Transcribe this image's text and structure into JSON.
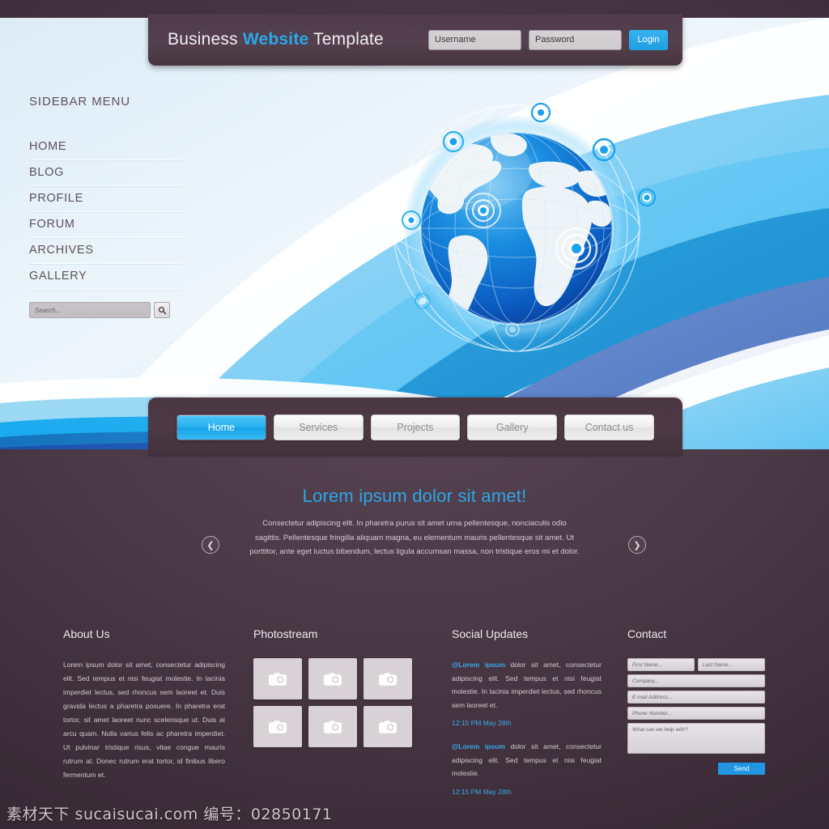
{
  "header": {
    "title_pre": "Business ",
    "title_accent": "Website",
    "title_post": " Template",
    "username_placeholder": "Username",
    "password_placeholder": "Password",
    "login_label": "Login"
  },
  "sidebar": {
    "title": "SIDEBAR MENU",
    "items": [
      {
        "label": "HOME"
      },
      {
        "label": "BLOG"
      },
      {
        "label": "PROFILE"
      },
      {
        "label": "FORUM"
      },
      {
        "label": "ARCHIVES"
      },
      {
        "label": "GALLERY"
      }
    ],
    "search_placeholder": "Search...",
    "search_icon": "search-icon"
  },
  "nav": {
    "items": [
      {
        "label": "Home",
        "active": true
      },
      {
        "label": "Services",
        "active": false
      },
      {
        "label": "Projects",
        "active": false
      },
      {
        "label": "Gallery",
        "active": false
      },
      {
        "label": "Contact us",
        "active": false
      }
    ]
  },
  "slider": {
    "title": "Lorem ipsum dolor sit amet!",
    "body": "Consectetur adipiscing elit. In pharetra purus sit amet urna pellentesque, nonciaculis odio sagittis. Pellentesque fringilla aliquam magna, eu elementum mauris pellentesque sit amet. Ut porttitor, ante eget luctus bibendum, lectus ligula accumsan massa, non tristique eros mi et dolor.",
    "prev_icon": "chevron-left-icon",
    "prev_glyph": "❮",
    "next_icon": "chevron-right-icon",
    "next_glyph": "❯"
  },
  "footer": {
    "about": {
      "title": "About Us",
      "text": "Lorem ipsum dolor sit amet, consectetur adipiscing elit. Sed tempus et nisi feugiat molestie. In lacinia imperdiet lectus, sed rhoncus sem laoreet et. Duis gravida lectus a pharetra posuere. In pharetra erat tortor, sit amet laoreet nunc scelerisque ut. Duis at arcu quam. Nulla varius felis ac pharetra imperdiet. Ut pulvinar tristique risus, vitae congue mauris rutrum at. Donec rutrum erat tortor, id finibus libero fermentum et."
    },
    "photostream": {
      "title": "Photostream",
      "cell_icon": "camera-icon",
      "cells": [
        1,
        2,
        3,
        4,
        5,
        6
      ]
    },
    "social": {
      "title": "Social Updates",
      "updates": [
        {
          "handle": "@Lorem ipsum",
          "text": " dolor sit amet, consectetur adipiscing elit. Sed tempus et nisi feugiat molestie. In lacinia imperdiet lectus, sed rhoncus sem laoreet et.",
          "time": "12:15 PM May 28th"
        },
        {
          "handle": "@Lorem ipsum",
          "text": " dolor sit amet, consectetur adipiscing elit. Sed tempus et nisi feugiat molestie.",
          "time": "12:15 PM May 28th"
        }
      ]
    },
    "contact": {
      "title": "Contact",
      "first_name_placeholder": "First Name...",
      "last_name_placeholder": "Last Name...",
      "company_placeholder": "Company...",
      "email_placeholder": "E-mail Address...",
      "phone_placeholder": "Phone Number...",
      "message_placeholder": "What can we help with?",
      "send_label": "Send"
    }
  },
  "hero": {
    "graphic": "globe-network-illustration"
  },
  "watermark": {
    "text": "素材天下 sucaisucai.com 编号：02850171"
  },
  "colors": {
    "accent_blue": "#28a8e8",
    "dark_panel": "#4a3742",
    "hero_light": "#e4f0f9"
  }
}
